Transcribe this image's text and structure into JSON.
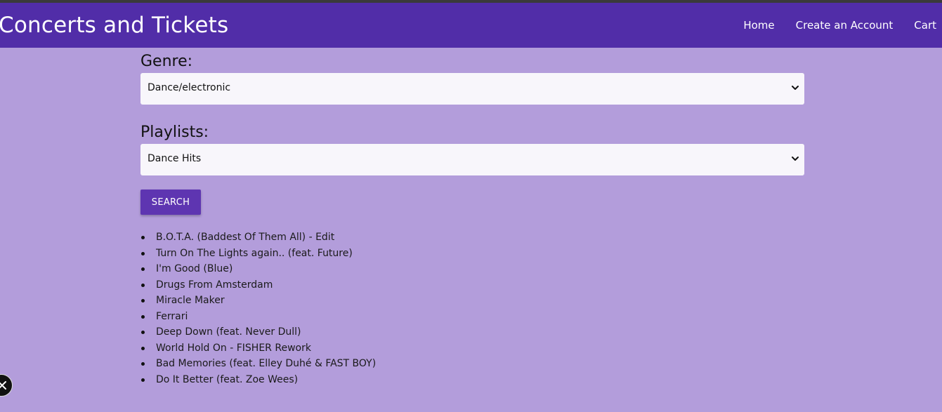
{
  "navbar": {
    "brand": "Concerts and Tickets",
    "links": [
      "Home",
      "Create an Account",
      "Cart"
    ],
    "background": "#512da8"
  },
  "form": {
    "genre_label": "Genre:",
    "genre_value": "Dance/electronic",
    "playlists_label": "Playlists:",
    "playlist_value": "Dance Hits",
    "search_label": "SEARCH",
    "button_color": "#5e35b1"
  },
  "results": [
    "B.O.T.A. (Baddest Of Them All) - Edit",
    "Turn On The Lights again.. (feat. Future)",
    "I'm Good (Blue)",
    "Drugs From Amsterdam",
    "Miracle Maker",
    "Ferrari",
    "Deep Down (feat. Never Dull)",
    "World Hold On - FISHER Rework",
    "Bad Memories (feat. Elley Duhé & FAST BOY)",
    "Do It Better (feat. Zoe Wees)"
  ],
  "page_background": "#b39ddb",
  "icons": {
    "select_arrow": "chevron-down-icon",
    "floating_button": "close-icon"
  }
}
